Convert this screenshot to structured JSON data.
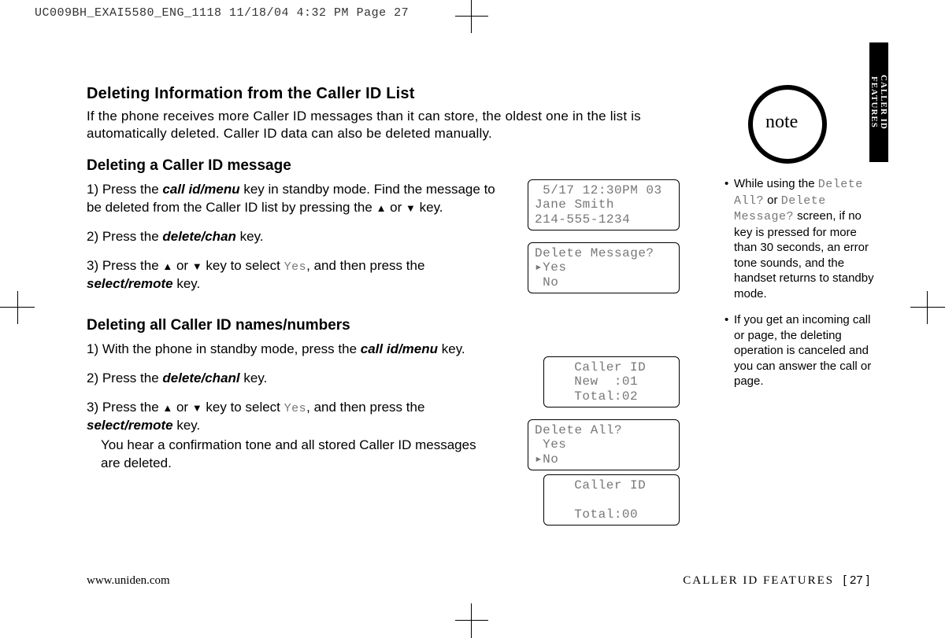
{
  "slug": "UC009BH_EXAI5580_ENG_1118  11/18/04  4:32 PM  Page 27",
  "main": {
    "h_top": "Deleting Information from the Caller ID List",
    "intro": "If the phone receives more Caller ID messages than it can store, the oldest one in the list is automatically deleted. Caller ID data can also be deleted manually.",
    "h_sub1": "Deleting a Caller ID message",
    "s1_1a": "1) Press the ",
    "s1_1b": " key in standby mode. Find the message to be deleted from the Caller ID list by pressing the ",
    "s1_1c": " or ",
    "s1_1d": " key.",
    "key_callidmenu": "call id/menu",
    "s1_2a": "2) Press the ",
    "key_deletechan": "delete/chan",
    "s1_2b": " key.",
    "s1_3a": "3) Press the ",
    "s1_3b": " or ",
    "s1_3c": " key to select ",
    "yes_lcd": "Yes",
    "s1_3d": ", and then press the ",
    "key_selectremote": "select/remote",
    "s1_3e": " key.",
    "h_sub2": "Deleting all Caller ID names/numbers",
    "s2_1a": "1) With the phone in standby mode, press the ",
    "s2_1b": " key.",
    "s2_2a": "2) Press the ",
    "key_deletechanl": "delete/chanl",
    "s2_2b": " key.",
    "s2_3a": "3) Press the ",
    "s2_3b": " or ",
    "s2_3c": " key to select ",
    "s2_3d": ", and then press the ",
    "s2_3e": " key.",
    "s2_3f": "You hear a confirmation tone and all stored Caller ID messages are deleted."
  },
  "lcd": {
    "box1": " 5/17 12:30PM 03\nJane Smith\n214-555-1234",
    "box2": "Delete Message?\n▸Yes\n No",
    "box3": "   Caller ID\n   New  :01\n   Total:02",
    "box4": "Delete All?\n Yes\n▸No",
    "box5": "   Caller ID\n\n   Total:00"
  },
  "side": {
    "note_label": "note",
    "n1a": "While using the ",
    "n1_lcd1": "Delete All?",
    "n1b": " or ",
    "n1_lcd2": "Delete Message?",
    "n1c": " screen, if no key is pressed for more than 30 seconds, an error tone sounds, and the handset returns to standby mode.",
    "n2": "If you get an incoming call or page, the deleting operation is canceled and you can answer the call or page."
  },
  "tab": "CALLER ID\nFEATURES",
  "footer": {
    "site": "www.uniden.com",
    "section": "CALLER ID FEATURES",
    "page": "[ 27 ]"
  }
}
